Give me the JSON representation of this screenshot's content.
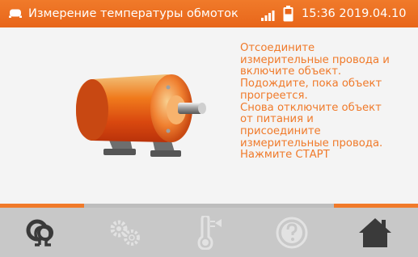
{
  "header": {
    "title": "Измерение температуры обмоток",
    "datetime": "15:36 2019.04.10",
    "icons": [
      "app-icon",
      "signal-icon",
      "battery-icon"
    ],
    "accent_color": "#f07a2a"
  },
  "main": {
    "illustration": "motor-icon",
    "instructions": "Отсоедините\nизмерительные провода и\nвключите объект.\nПодождите, пока объект\nпрогреется.\nСнова отключите объект\nот питания и\nприсоедините\nизмерительные провода.\nНажмите СТАРТ"
  },
  "bottom_nav": {
    "active_index": 0,
    "items": [
      {
        "icon": "measurement-icon",
        "enabled": true
      },
      {
        "icon": "settings-icon",
        "enabled": false
      },
      {
        "icon": "thermometer-icon",
        "enabled": false
      },
      {
        "icon": "help-icon",
        "enabled": false
      },
      {
        "icon": "home-icon",
        "enabled": true
      }
    ]
  }
}
